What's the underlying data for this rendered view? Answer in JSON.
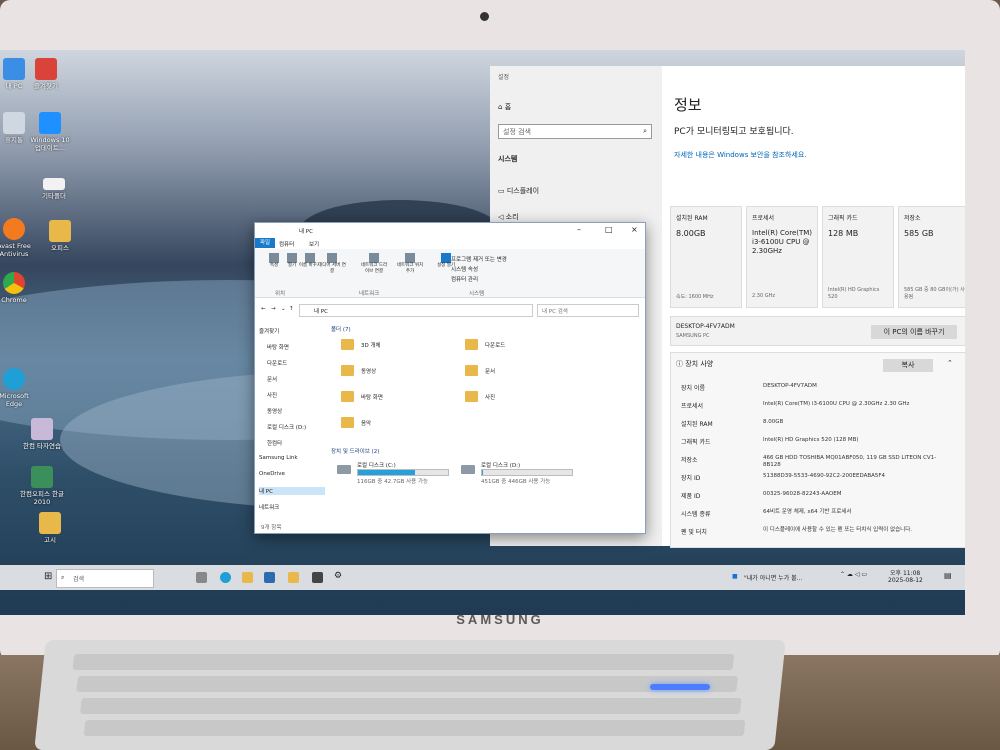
{
  "monitor": {
    "brand": "SAMSUNG"
  },
  "desktop_icons": [
    {
      "label": "내 PC",
      "color": "#3a8ee6"
    },
    {
      "label": "휴지통",
      "color": "#cfd8e0"
    },
    {
      "label": "Windows 10 업데이트...",
      "color": "#1e90ff"
    },
    {
      "label": "Avast Free Antivirus",
      "color": "#f47a20"
    },
    {
      "label": "Chrome",
      "color": "#e0452f"
    },
    {
      "label": "Microsoft Edge",
      "color": "#1e9fd6"
    },
    {
      "label": "한컴 타자연습",
      "color": "#c9b9d9"
    },
    {
      "label": "한컴오피스 한글 2010",
      "color": "#3a8f5a"
    },
    {
      "label": "고시",
      "color": "#e8b84a"
    },
    {
      "label": "즐겨찾기",
      "color": "#d9433a"
    },
    {
      "label": "기타폴더",
      "color": "#f2f2f2"
    },
    {
      "label": "오피스",
      "color": "#e8b84a"
    }
  ],
  "settings": {
    "window_title": "설정",
    "home": "홈",
    "search_placeholder": "설정 검색",
    "section": "시스템",
    "nav_display": "디스플레이",
    "nav_sound": "소리",
    "page_title": "정보",
    "subtitle": "PC가 모니터링되고 보호됩니다.",
    "link": "자세한 내용은 Windows 보안을 참조하세요.",
    "cards": [
      {
        "title": "설치된 RAM",
        "value": "8.00GB",
        "detail": "속도: 1600 MHz"
      },
      {
        "title": "프로세서",
        "value": "Intel(R) Core(TM) i3-6100U CPU @ 2.30GHz",
        "detail": "2.30 GHz"
      },
      {
        "title": "그래픽 카드",
        "value": "128 MB",
        "detail": "Intel(R) HD Graphics 520"
      },
      {
        "title": "저장소",
        "value": "585 GB",
        "detail": "585 GB 중 80 GB이(가) 사용됨"
      }
    ],
    "device_name": "DESKTOP-4FV7ADM",
    "device_model": "SAMSUNG PC",
    "rename_button": "이 PC의 이름 바꾸기",
    "specs_header": "장치 사양",
    "copy_button": "복사",
    "specs": [
      {
        "label": "장치 이름",
        "value": "DESKTOP-4FV7ADM"
      },
      {
        "label": "프로세서",
        "value": "Intel(R) Core(TM) i3-6100U CPU @ 2.30GHz 2.30 GHz"
      },
      {
        "label": "설치된 RAM",
        "value": "8.00GB"
      },
      {
        "label": "그래픽 카드",
        "value": "Intel(R) HD Graphics 520 (128 MB)"
      },
      {
        "label": "저장소",
        "value": "466 GB HDD TOSHIBA MQ01ABF050, 119 GB SSD LITEON CV1-8B128"
      },
      {
        "label": "장치 ID",
        "value": "51388D39-5533-4690-92C2-200EEDABA5F4"
      },
      {
        "label": "제품 ID",
        "value": "00325-96028-82243-AAOEM"
      },
      {
        "label": "시스템 종류",
        "value": "64비트 운영 체제, x64 기반 프로세서"
      },
      {
        "label": "펜 및 터치",
        "value": "이 디스플레이에 사용할 수 있는 펜 또는 터치식 입력이 없습니다."
      }
    ]
  },
  "explorer": {
    "title": "내 PC",
    "tabs": [
      "파일",
      "컴퓨터",
      "보기"
    ],
    "ribbon": [
      "속성",
      "열기",
      "이름 바꾸기",
      "미디어 서버 연결",
      "네트워크 드라이브 연결",
      "네트워크 위치 추가",
      "설정 열기"
    ],
    "ribbon_system": [
      "프로그램 제거 또는 변경",
      "시스템 속성",
      "컴퓨터 관리"
    ],
    "groups": [
      "위치",
      "네트워크",
      "시스템"
    ],
    "address": "내 PC",
    "search_placeholder": "내 PC 검색",
    "folders_header": "폴더 (7)",
    "folders": [
      "3D 개체",
      "다운로드",
      "동영상",
      "문서",
      "바탕 화면",
      "사진",
      "음악"
    ],
    "drives_header": "장치 및 드라이브 (2)",
    "drives": [
      {
        "name": "로컬 디스크 (C:)",
        "free": "116GB 중 42.7GB 사용 가능",
        "used_fraction": 0.63
      },
      {
        "name": "로컬 디스크 (D:)",
        "free": "451GB 중 446GB 사용 가능",
        "used_fraction": 0.01
      }
    ],
    "nav": [
      "즐겨찾기",
      "바탕 화면",
      "다운로드",
      "문서",
      "사진",
      "동영상",
      "로컬 디스크 (D:)",
      "한컴타",
      "Samsung Link",
      "OneDrive",
      "내 PC",
      "네트워크"
    ],
    "status": "9개 항목"
  },
  "taskbar": {
    "search_placeholder": "검색",
    "notification": "\"내가 아니면 누가 볼...",
    "time": "오후 11:08",
    "date": "2025-08-12"
  }
}
